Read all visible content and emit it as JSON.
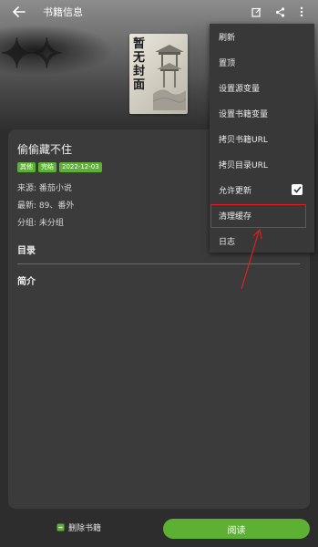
{
  "header": {
    "title": "书籍信息",
    "back_icon": "arrow-left-icon",
    "actions": [
      "edit-icon",
      "share-icon",
      "more-vert-icon"
    ]
  },
  "cover": {
    "placeholder_text": "暂无封面"
  },
  "book": {
    "name": "偷偷藏不住",
    "tags": [
      "其他",
      "完结",
      "2022-12-03"
    ],
    "source": "来源: 番茄小说",
    "latest": "最新: 89、番外",
    "group": "分组: 未分组"
  },
  "sections": {
    "toc": "目录",
    "intro": "简介"
  },
  "bottom": {
    "delete_label": "删除书籍",
    "read_label": "阅读"
  },
  "menu": {
    "items": [
      "刷新",
      "置顶",
      "设置源变量",
      "设置书籍变量",
      "拷贝书籍URL",
      "拷贝目录URL",
      "允许更新",
      "清理缓存",
      "日志"
    ],
    "allow_update_checked": true,
    "highlighted_item": "清理缓存"
  },
  "colors": {
    "accent": "#5cb132",
    "annotation": "#e02020",
    "background": "#2d2d2d",
    "card": "#3b3b3b",
    "menu": "#383838"
  }
}
